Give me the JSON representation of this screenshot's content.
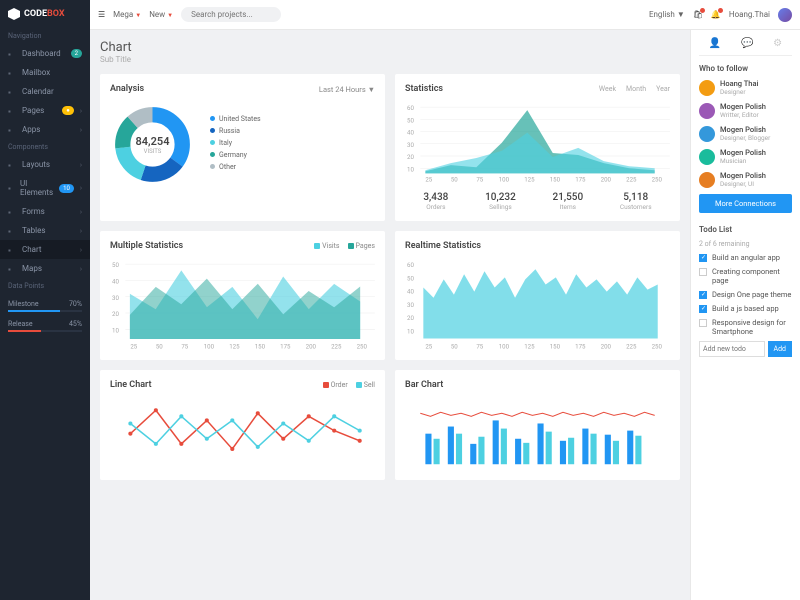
{
  "brand": {
    "name": "CODE",
    "suffix": "BOX"
  },
  "topbar": {
    "mega": "Mega",
    "new": "New",
    "search_placeholder": "Search projects...",
    "lang": "English",
    "user": "Hoang.Thai"
  },
  "nav": {
    "section1": "Navigation",
    "items1": [
      {
        "label": "Dashboard",
        "badge": "2",
        "badgeClass": "badge-green"
      },
      {
        "label": "Mailbox"
      },
      {
        "label": "Calendar"
      },
      {
        "label": "Pages",
        "badge": "●",
        "badgeClass": "badge-yellow",
        "chevron": true
      },
      {
        "label": "Apps",
        "chevron": true
      }
    ],
    "section2": "Components",
    "items2": [
      {
        "label": "Layouts",
        "chevron": true
      },
      {
        "label": "UI Elements",
        "badge": "10",
        "badgeClass": "badge-blue",
        "chevron": true
      },
      {
        "label": "Forms",
        "chevron": true
      },
      {
        "label": "Tables",
        "chevron": true
      },
      {
        "label": "Chart",
        "active": true,
        "chevron": true
      },
      {
        "label": "Maps",
        "chevron": true
      }
    ],
    "section3": "Data Points",
    "milestone": {
      "label": "Milestone",
      "value": "70%",
      "pct": 70,
      "color": "#2196f3"
    },
    "release": {
      "label": "Release",
      "value": "45%",
      "pct": 45,
      "color": "#e74c3c"
    }
  },
  "page": {
    "title": "Chart",
    "sub": "Sub Title"
  },
  "analysis": {
    "title": "Analysis",
    "dropdown": "Last 24 Hours",
    "center_num": "84,254",
    "center_lbl": "VISITS",
    "legend": [
      {
        "label": "United States",
        "color": "#2196f3"
      },
      {
        "label": "Russia",
        "color": "#1565c0"
      },
      {
        "label": "Italy",
        "color": "#4dd0e1"
      },
      {
        "label": "Germany",
        "color": "#26a69a"
      },
      {
        "label": "Other",
        "color": "#b0bec5"
      }
    ]
  },
  "statistics": {
    "title": "Statistics",
    "tabs": [
      "Week",
      "Month",
      "Year"
    ],
    "metrics": [
      {
        "num": "3,438",
        "lbl": "Orders"
      },
      {
        "num": "10,232",
        "lbl": "Sellings"
      },
      {
        "num": "21,550",
        "lbl": "Items"
      },
      {
        "num": "5,118",
        "lbl": "Customers"
      }
    ]
  },
  "multiple": {
    "title": "Multiple Statistics",
    "legend": [
      {
        "label": "Visits",
        "color": "#4dd0e1"
      },
      {
        "label": "Pages",
        "color": "#26a69a"
      }
    ]
  },
  "realtime": {
    "title": "Realtime Statistics"
  },
  "line": {
    "title": "Line Chart",
    "legend": [
      {
        "label": "Order",
        "color": "#e74c3c"
      },
      {
        "label": "Sell",
        "color": "#4dd0e1"
      }
    ]
  },
  "bar": {
    "title": "Bar Chart"
  },
  "rightbar": {
    "follow_title": "Who to follow",
    "follows": [
      {
        "name": "Hoang Thai",
        "role": "Designer",
        "color": "#f39c12"
      },
      {
        "name": "Mogen Polish",
        "role": "Writter, Editor",
        "color": "#9b59b6"
      },
      {
        "name": "Mogen Polish",
        "role": "Designer, Blogger",
        "color": "#3498db"
      },
      {
        "name": "Mogen Polish",
        "role": "Musician",
        "color": "#1abc9c"
      },
      {
        "name": "Mogen Polish",
        "role": "Designer, UI",
        "color": "#e67e22"
      }
    ],
    "more_btn": "More Connections",
    "todo_title": "Todo List",
    "todo_sub": "2 of 6 remaining",
    "todos": [
      {
        "text": "Build an angular app",
        "done": true
      },
      {
        "text": "Creating component page",
        "done": false
      },
      {
        "text": "Design One page theme",
        "done": true
      },
      {
        "text": "Build a js based app",
        "done": true
      },
      {
        "text": "Responsive design for Smartphone",
        "done": false
      }
    ],
    "todo_placeholder": "Add new todo",
    "add_btn": "Add"
  },
  "chart_data": [
    {
      "type": "pie",
      "title": "Analysis",
      "series": [
        {
          "name": "United States",
          "value": 35
        },
        {
          "name": "Russia",
          "value": 20
        },
        {
          "name": "Italy",
          "value": 18
        },
        {
          "name": "Germany",
          "value": 15
        },
        {
          "name": "Other",
          "value": 12
        }
      ]
    },
    {
      "type": "area",
      "title": "Statistics",
      "x": [
        25,
        50,
        75,
        100,
        125,
        150,
        175,
        200,
        225,
        250
      ],
      "series": [
        {
          "name": "s1",
          "values": [
            5,
            10,
            8,
            28,
            55,
            18,
            15,
            8,
            5,
            3
          ]
        },
        {
          "name": "s2",
          "values": [
            3,
            6,
            12,
            18,
            30,
            12,
            20,
            10,
            6,
            4
          ]
        }
      ],
      "ylim": [
        0,
        60
      ]
    },
    {
      "type": "area",
      "title": "Multiple Statistics",
      "x": [
        25,
        50,
        75,
        100,
        125,
        150,
        175,
        200,
        225,
        250
      ],
      "series": [
        {
          "name": "Visits",
          "values": [
            30,
            18,
            48,
            20,
            35,
            12,
            42,
            18,
            38,
            25
          ]
        },
        {
          "name": "Pages",
          "values": [
            15,
            35,
            22,
            40,
            18,
            38,
            15,
            32,
            20,
            35
          ]
        }
      ],
      "ylim": [
        0,
        50
      ]
    },
    {
      "type": "area",
      "title": "Realtime Statistics",
      "x": [
        25,
        50,
        75,
        100,
        125,
        150,
        175,
        200,
        225,
        250
      ],
      "values": [
        42,
        35,
        48,
        38,
        52,
        40,
        55,
        42,
        50,
        35,
        48,
        40,
        55,
        45,
        50,
        38,
        52,
        42,
        48,
        40
      ],
      "ylim": [
        0,
        60
      ]
    },
    {
      "type": "line",
      "title": "Line Chart",
      "x": [
        25,
        50,
        75,
        100,
        125,
        150,
        175,
        200,
        225,
        250
      ],
      "series": [
        {
          "name": "Order",
          "values": [
            28,
            45,
            20,
            38,
            15,
            42,
            25,
            40,
            30,
            22
          ]
        },
        {
          "name": "Sell",
          "values": [
            35,
            20,
            42,
            25,
            38,
            18,
            35,
            22,
            40,
            30
          ]
        }
      ],
      "ylim": [
        0,
        50
      ]
    },
    {
      "type": "bar",
      "title": "Bar Chart",
      "x": [
        25,
        50,
        75,
        100,
        125,
        150,
        175,
        200,
        225,
        250
      ],
      "series": [
        {
          "name": "line",
          "values": [
            45,
            43,
            46,
            44,
            45,
            43,
            46,
            44,
            45,
            43,
            46,
            44,
            45,
            43,
            46,
            44,
            45,
            43,
            46,
            44
          ]
        },
        {
          "name": "bars1",
          "values": [
            30,
            35,
            20,
            40,
            25,
            38,
            22,
            35,
            28,
            32
          ]
        },
        {
          "name": "bars2",
          "values": [
            25,
            30,
            28,
            35,
            22,
            32,
            26,
            30,
            24,
            28
          ]
        }
      ],
      "ylim": [
        0,
        50
      ]
    }
  ]
}
